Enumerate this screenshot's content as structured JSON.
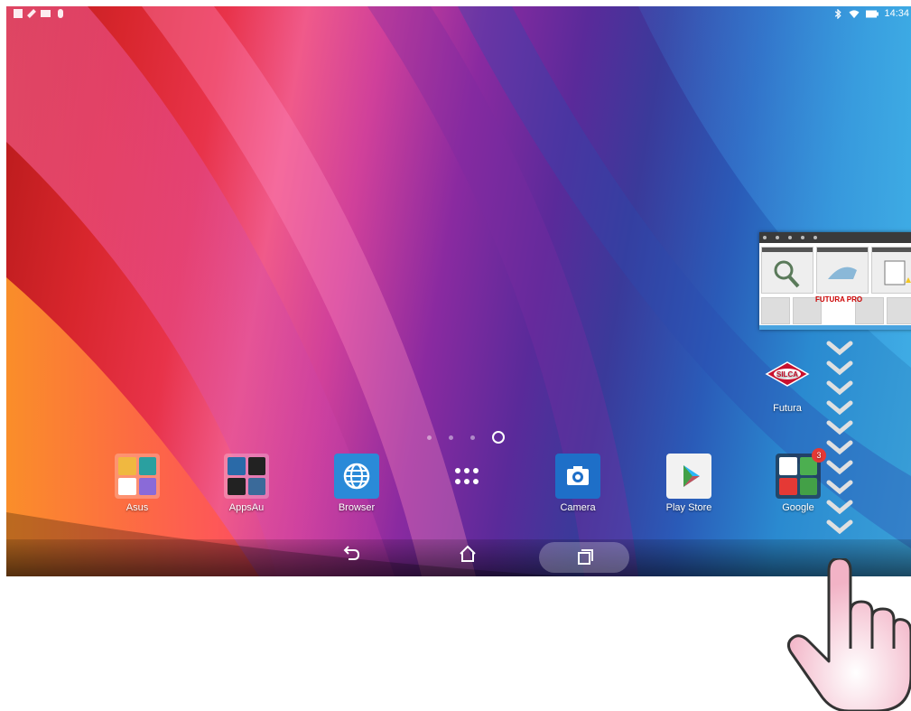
{
  "status_bar": {
    "time": "14:34",
    "left_icons": [
      "notification-icon",
      "wrench-icon",
      "message-icon",
      "location-icon"
    ],
    "right_icons": [
      "bluetooth-icon",
      "wifi-icon",
      "battery-icon"
    ]
  },
  "pager": {
    "pages": 4,
    "current": 4
  },
  "dock": {
    "apps": [
      {
        "label": "Asus"
      },
      {
        "label": "AppsAu"
      },
      {
        "label": "Browser"
      },
      {
        "label": ""
      },
      {
        "label": "Camera"
      },
      {
        "label": "Play Store"
      },
      {
        "label": "Google"
      }
    ],
    "google_badge": "3"
  },
  "widget": {
    "brand": "FUTURA PRO"
  },
  "shortcut": {
    "label": "Futura",
    "logo_text": "SILCA"
  },
  "colors": {
    "accent": "#4aa3df",
    "badge": "#e53935",
    "hand_fill": "#f7c9d6"
  }
}
